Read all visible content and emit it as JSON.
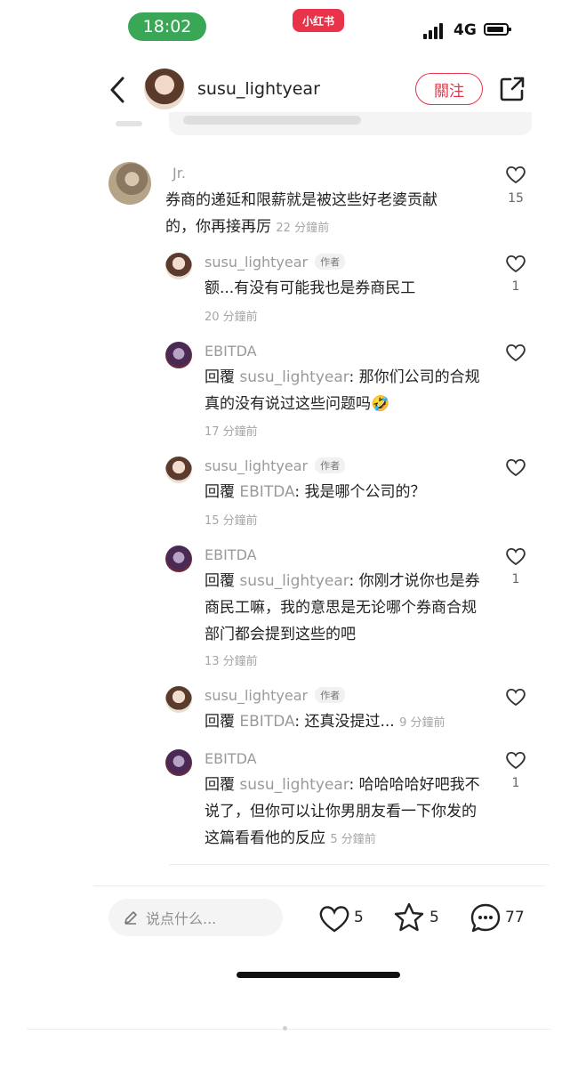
{
  "status_bar": {
    "time": "18:02",
    "app_badge": "小红书",
    "network": "4G"
  },
  "header": {
    "username": "susu_lightyear",
    "follow_label": "關注"
  },
  "top_comment": {
    "username": "Jr.",
    "text": "券商的递延和限薪就是被这些好老婆贡献的，你再接再厉",
    "time": "22 分鐘前",
    "likes": "15"
  },
  "replies": [
    {
      "username": "susu_lightyear",
      "author_tag": "作者",
      "reply_prefix": "",
      "reply_to": "",
      "text": "额...有没有可能我也是券商民工",
      "time": "20 分鐘前",
      "likes": "1"
    },
    {
      "username": "EBITDA",
      "author_tag": "",
      "reply_prefix": "回覆 ",
      "reply_to": "susu_lightyear",
      "text": ": 那你们公司的合规真的没有说过这些问题吗🤣",
      "time": "17 分鐘前",
      "likes": ""
    },
    {
      "username": "susu_lightyear",
      "author_tag": "作者",
      "reply_prefix": "回覆 ",
      "reply_to": "EBITDA",
      "text": ": 我是哪个公司的？",
      "time": "15 分鐘前",
      "likes": ""
    },
    {
      "username": "EBITDA",
      "author_tag": "",
      "reply_prefix": "回覆 ",
      "reply_to": "susu_lightyear",
      "text": ": 你刚才说你也是券商民工嘛，我的意思是无论哪个券商合规部门都会提到这些的吧",
      "time": "13 分鐘前",
      "likes": "1"
    },
    {
      "username": "susu_lightyear",
      "author_tag": "作者",
      "reply_prefix": "回覆 ",
      "reply_to": "EBITDA",
      "text": ": 还真没提过...",
      "time": "9 分鐘前",
      "likes": ""
    },
    {
      "username": "EBITDA",
      "author_tag": "",
      "reply_prefix": "回覆 ",
      "reply_to": "susu_lightyear",
      "text": ": 哈哈哈哈好吧我不说了，但你可以让你男朋友看一下你发的这篇看看他的反应",
      "time": "5 分鐘前",
      "likes": "1"
    }
  ],
  "bottom_bar": {
    "input_placeholder": "说点什么...",
    "like_count": "5",
    "star_count": "5",
    "comment_count": "77"
  },
  "colors": {
    "accent": "#e8334a",
    "time_pill": "#3aa757"
  },
  "icons": [
    "back-arrow-icon",
    "share-icon",
    "heart-icon",
    "star-icon",
    "comment-icon",
    "pencil-icon"
  ]
}
